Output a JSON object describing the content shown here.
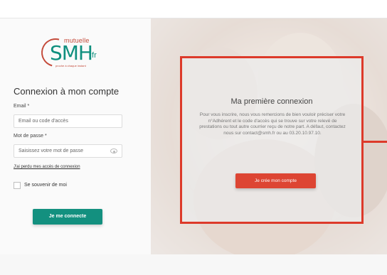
{
  "logo": {
    "brand_top": "mutuelle",
    "brand_main": "SMH",
    "brand_tld": ".fr",
    "tagline": "proche à chaque instant"
  },
  "login": {
    "title": "Connexion à mon compte",
    "email_label": "Email *",
    "email_placeholder": "Email ou code d'accès",
    "password_label": "Mot de passe *",
    "password_placeholder": "Saisissez votre mot de passe",
    "lost_access_link": "J'ai perdu mes accès de connexion",
    "remember_label": "Se souvenir de moi",
    "connect_button": "Je me connecte"
  },
  "first_connection": {
    "title": "Ma première connexion",
    "text": "Pour vous inscrire, nous vous remercions de bien vouloir préciser votre n°Adhérent et le code d'accès qui se trouve sur votre relevé de prestations ou tout autre courrier reçu de notre part. A défaut, contactez nous sur contact@smh.fr ou au 03.20.10.97.10.",
    "button": "Je crée mon compte"
  },
  "colors": {
    "brand_teal": "#13907f",
    "brand_red": "#dd4533",
    "highlight_red": "#dd3a2a"
  }
}
